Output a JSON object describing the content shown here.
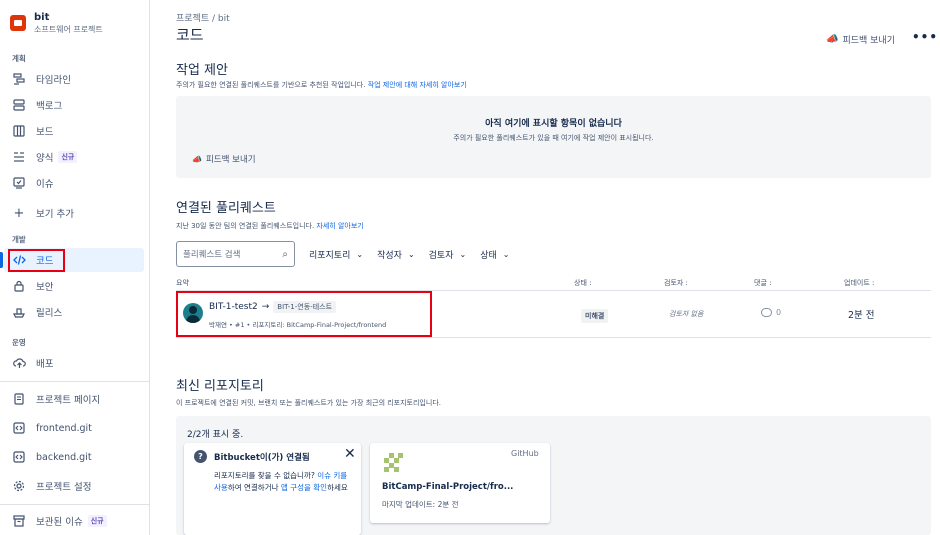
{
  "sidebar": {
    "project_name": "bit",
    "project_type": "소프트웨어 프로젝트",
    "sections": {
      "planning": "계획",
      "development": "개발",
      "operations": "운영"
    },
    "items": {
      "timeline": "타임라인",
      "backlog": "백로그",
      "board": "보드",
      "forms": "양식",
      "forms_badge": "신규",
      "issues": "이슈",
      "add_view": "보기 추가",
      "code": "코드",
      "security": "보안",
      "releases": "릴리스",
      "deployments": "배포",
      "project_pages": "프로젝트 페이지",
      "frontend": "frontend.git",
      "backend": "backend.git",
      "project_settings": "프로젝트 설정",
      "archived_issues": "보관된 이슈",
      "archived_badge": "신규"
    }
  },
  "header": {
    "breadcrumb": "프로젝트  /  bit",
    "title": "코드",
    "feedback": "피드백 보내기",
    "more": "•••"
  },
  "work_suggestions": {
    "heading": "작업 제안",
    "desc": "주의가 필요한 연결된 풀리퀘스트를 기반으로 추천된 작업입니다.",
    "link": "작업 제안에 대해 자세히 알아보기",
    "empty_title": "아직 여기에 표시할 항목이 없습니다",
    "empty_desc": "주의가 필요한 풀리퀘스트가 있을 때 여기에 작업 제안이 표시됩니다.",
    "feedback": "피드백 보내기"
  },
  "pull_requests": {
    "heading": "연결된 풀리퀘스트",
    "desc": "지난 30일 동안 팀의 연결된 풀리퀘스트입니다.",
    "link": "자세히 알아보기",
    "search_placeholder": "풀리퀘스트 검색",
    "filters": [
      "리포지토리",
      "작성자",
      "검토자",
      "상태"
    ],
    "columns": {
      "summary": "요약",
      "status": "상태 :",
      "reviewer": "검토자 :",
      "comments": "댓글 :",
      "updated": "업데이트 :"
    },
    "rows": [
      {
        "title": "BIT-1-test2",
        "arrow": "→",
        "branch": "BIT-1-연동-테스트",
        "meta": "박재연 • #1 • 리포지토리: BitCamp-Final-Project/frontend",
        "status": "미해결",
        "reviewer": "검토자 없음",
        "comments": "0",
        "updated": "2분 전"
      }
    ]
  },
  "repositories": {
    "heading": "최신 리포지토리",
    "desc": "이 프로젝트에 연결된 커밋, 브랜치 또는 풀리퀘스트가 있는 가장 최근의 리포지토리입니다.",
    "count": "2/2개 표시 중.",
    "bitbucket_card": {
      "title": "Bitbucket이(가) 연결됨",
      "close": "✕",
      "body_1": "리포지토리를 찾을 수 없습니까? ",
      "link_1": "이슈 키를 사용",
      "body_2": "하여 연결하거나 ",
      "link_2": "앱 구성을 확인",
      "body_3": "하세요"
    },
    "repo_card": {
      "provider": "GitHub",
      "name": "BitCamp-Final-Project/fro...",
      "updated": "마지막 업데이트: 2분 전"
    }
  }
}
